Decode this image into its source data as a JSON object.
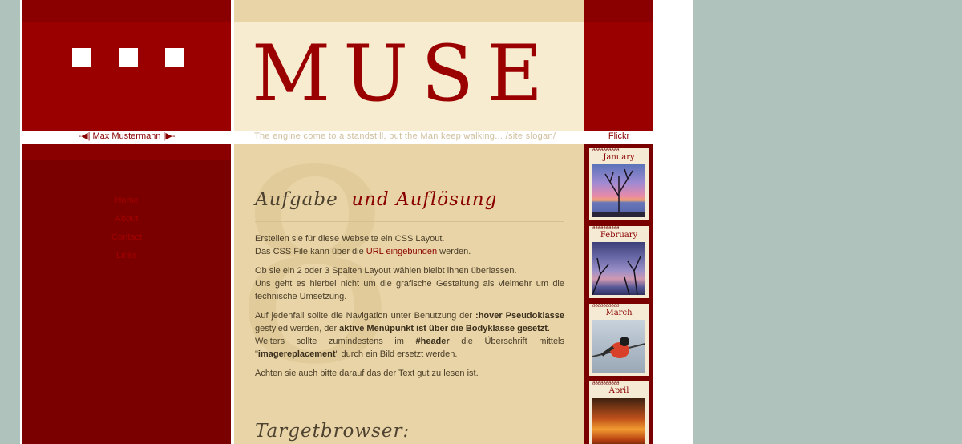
{
  "header": {
    "logo": "MUSE",
    "author_bar": "-◀| Max Mustermann |▶-",
    "slogan": "The engine come to a standstill, but the Man keep walking... /site slogan/",
    "flickr_title": "Flickr"
  },
  "nav": {
    "items": [
      {
        "label": "Home"
      },
      {
        "label": "About"
      },
      {
        "label": "Contact"
      },
      {
        "label": "Links"
      }
    ]
  },
  "content": {
    "background_numeral": "8",
    "title_part1": "Aufgabe",
    "title_part2": "und Auflösung",
    "p1_a": "Erstellen sie für diese Webseite ein ",
    "p1_abbr": "CSS",
    "p1_b": " Layout.",
    "p1_c": "Das CSS File kann über die ",
    "p1_link": "URL eingebunden",
    "p1_d": " werden.",
    "p2_a": "Ob sie ein 2 oder 3 Spalten Layout wählen bleibt ihnen überlassen.",
    "p2_b": "Uns geht es hierbei nicht um die grafische Gestaltung als vielmehr um die technische Umsetzung.",
    "p3_a": "Auf jedenfall sollte die Navigation unter Benutzung der ",
    "p3_b1": ":hover Pseudoklasse",
    "p3_c": " gestyled werden, der ",
    "p3_b2": "aktive Menüpunkt ist über die Bodyklasse gesetzt",
    "p3_d": ".",
    "p3_e": "Weiters sollte zumindestens im ",
    "p3_b3": "#header",
    "p3_f": " die Überschrift mittels \"",
    "p3_b4": "imagereplacement",
    "p3_g": "\" durch ein Bild ersetzt werden.",
    "p4": "Achten sie auch bitte darauf das der Text gut zu lesen ist.",
    "subtitle": "Targetbrowser:"
  },
  "calendar": {
    "rings": "ðððððððððð",
    "months": [
      {
        "name": "January"
      },
      {
        "name": "February"
      },
      {
        "name": "March"
      },
      {
        "name": "April"
      }
    ]
  },
  "colors": {
    "page_bg": "#b0c2bc",
    "brand_red": "#9b0000",
    "dark_red": "#7a0000",
    "cream": "#f8ecd0",
    "tan": "#e8d4a6"
  }
}
